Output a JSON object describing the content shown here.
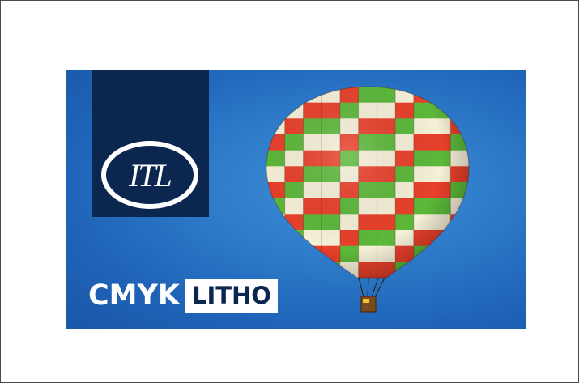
{
  "logo": {
    "mark_text": "ITL"
  },
  "brand": {
    "word1": "CMYK",
    "word2": "LITHO"
  },
  "colors": {
    "navy": "#0b2750",
    "sky_blue": "#2f7cca",
    "white": "#ffffff"
  },
  "illustration": "hot-air-balloon"
}
